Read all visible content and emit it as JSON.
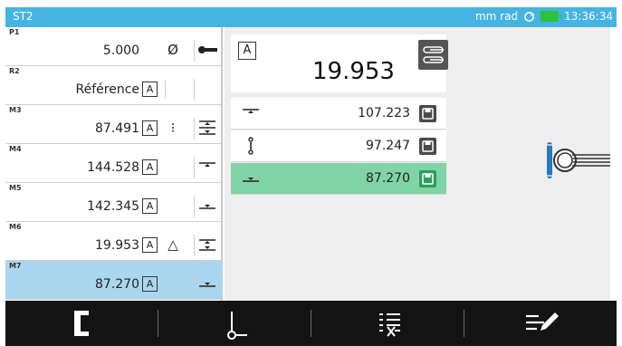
{
  "app": {
    "title": "ST2",
    "units": "mm rad",
    "time": "13:36:34"
  },
  "colors": {
    "title_bar": "#45b4e2",
    "selected_row": "#a9d6ee",
    "selected_measure": "#7fd3a4",
    "battery": "#2ec23a",
    "bottom_bar": "#141414"
  },
  "params": [
    {
      "label": "P1",
      "value": "5.000",
      "box": "",
      "col3": "Ø",
      "col4_icon": "probe-icon"
    },
    {
      "label": "R2",
      "value": "Référence",
      "box": "A",
      "col3": "",
      "col4_icon": ""
    },
    {
      "label": "M3",
      "value": "87.491",
      "box": "A",
      "col3": "⁝",
      "col4_icon": "max-min-icon"
    },
    {
      "label": "M4",
      "value": "144.528",
      "box": "A",
      "col3": "",
      "col4_icon": "max-icon"
    },
    {
      "label": "M5",
      "value": "142.345",
      "box": "A",
      "col3": "",
      "col4_icon": "min-icon"
    },
    {
      "label": "M6",
      "value": "19.953",
      "box": "A",
      "col3": "△",
      "col4_icon": "max-min-delta-icon"
    },
    {
      "label": "M7",
      "value": "87.270",
      "box": "A",
      "col3": "",
      "col4_icon": "min-icon"
    }
  ],
  "main_value": {
    "box": "A",
    "value": "19.953"
  },
  "measurements": [
    {
      "icon": "max-icon",
      "value": "107.223"
    },
    {
      "icon": "center-icon",
      "value": "97.247"
    },
    {
      "icon": "min-icon",
      "value": "87.270"
    }
  ],
  "toolbar": [
    {
      "name": "bracket-icon"
    },
    {
      "name": "height-probe-icon"
    },
    {
      "name": "list-delete-icon"
    },
    {
      "name": "list-edit-icon"
    }
  ]
}
